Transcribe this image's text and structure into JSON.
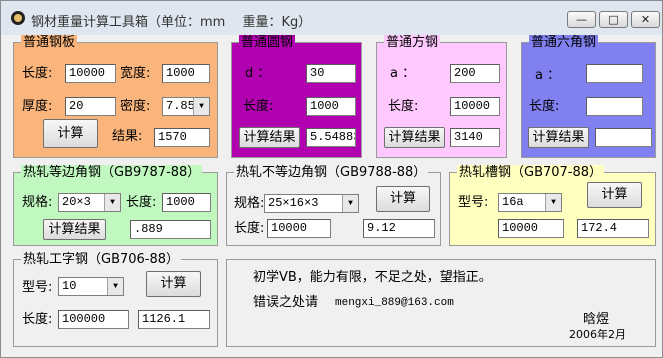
{
  "window": {
    "title": "钢材重量计算工具箱（单位：mm　 重量：Kg）",
    "min": "—",
    "max": "□",
    "close": "✕"
  },
  "plate": {
    "title": "普通钢板",
    "length_label": "长度:",
    "length_value": "10000",
    "width_label": "宽度:",
    "width_value": "1000",
    "thickness_label": "厚度:",
    "thickness_value": "20",
    "density_label": "密度:",
    "density_value": "7.85",
    "calc_label": "计算",
    "result_label": "结果:",
    "result_value": "1570"
  },
  "round": {
    "title": "普通圆钢",
    "d_label": "d ：",
    "d_value": "30",
    "length_label": "长度:",
    "length_value": "1000",
    "calc_label": "计算结果",
    "result_value": "5.548838"
  },
  "square": {
    "title": "普通方钢",
    "a_label": "a ：",
    "a_value": "200",
    "length_label": "长度:",
    "length_value": "10000",
    "calc_label": "计算结果",
    "result_value": "3140"
  },
  "hex": {
    "title": "普通六角钢",
    "a_label": "a ：",
    "a_value": "",
    "length_label": "长度:",
    "length_value": "",
    "calc_label": "计算结果",
    "result_value": ""
  },
  "equal_angle": {
    "title": "热轧等边角钢（GB9787-88）",
    "spec_label": "规格:",
    "spec_value": "20×3",
    "length_label": "长度:",
    "length_value": "1000",
    "calc_label": "计算结果",
    "result_value": ".889"
  },
  "unequal_angle": {
    "title": "热轧不等边角钢（GB9788-88）",
    "spec_label": "规格:",
    "spec_value": "25×16×3",
    "calc_label": "计算",
    "length_label": "长度:",
    "length_value": "10000",
    "result_value": "9.12"
  },
  "channel": {
    "title": "热轧槽钢（GB707-88）",
    "type_label": "型号:",
    "type_value": "16a",
    "calc_label": "计算",
    "length_value": "10000",
    "result_value": "172.4"
  },
  "ibeam": {
    "title": "热轧工字钢（GB706-88）",
    "type_label": "型号:",
    "type_value": "10",
    "calc_label": "计算",
    "length_label": "长度:",
    "length_value": "100000",
    "result_value": "1126.1"
  },
  "info": {
    "line1": "初学VB，能力有限，不足之处，望指正。",
    "line2_label": "错误之处请",
    "email": "mengxi_889@163.com",
    "author": "晗煜",
    "date": "2006年2月"
  },
  "colors": {
    "plate": "#f9b57b",
    "round": "#b000b0",
    "square": "#ffc8ff",
    "hex": "#8080f0",
    "equal_angle": "#c0f8c0",
    "unequal_angle": "#f0f0f0",
    "channel": "#ffffc0",
    "ibeam": "#f0f0f0",
    "info": "#f0f0f0"
  }
}
